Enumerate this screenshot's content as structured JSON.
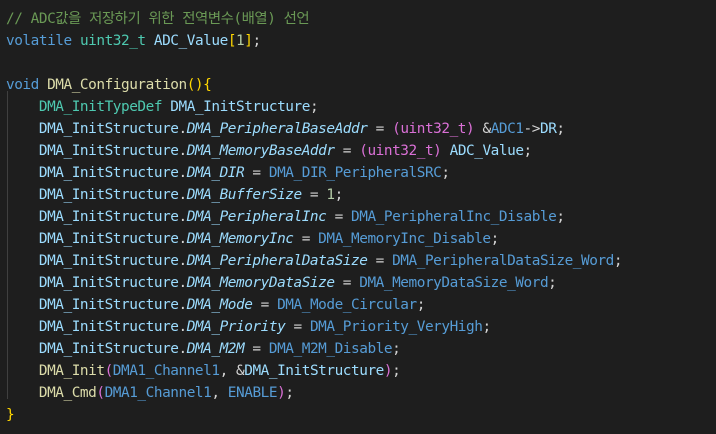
{
  "editor": {
    "lines": [
      [
        [
          "// ADC값을 저장하기 위한 전역변수(배열) 선언",
          "comment"
        ]
      ],
      [
        [
          "volatile",
          "keyword"
        ],
        [
          " ",
          "punct"
        ],
        [
          "uint32_t",
          "type"
        ],
        [
          " ",
          "punct"
        ],
        [
          "ADC_Value",
          "ident"
        ],
        [
          "[",
          "bracket1"
        ],
        [
          "1",
          "number"
        ],
        [
          "]",
          "bracket1"
        ],
        [
          ";",
          "punct"
        ]
      ],
      [],
      [
        [
          "void",
          "keyword"
        ],
        [
          " ",
          "punct"
        ],
        [
          "DMA_Configuration",
          "func"
        ],
        [
          "()",
          "bracket1"
        ],
        [
          "{",
          "bracket1"
        ]
      ],
      [
        [
          "    ",
          "punct"
        ],
        [
          "DMA_InitTypeDef",
          "type"
        ],
        [
          " ",
          "punct"
        ],
        [
          "DMA_InitStructure",
          "ident"
        ],
        [
          ";",
          "punct"
        ]
      ],
      [
        [
          "    ",
          "punct"
        ],
        [
          "DMA_InitStructure",
          "ident"
        ],
        [
          ".",
          "punct"
        ],
        [
          "DMA_PeripheralBaseAddr",
          "ident italic"
        ],
        [
          " = ",
          "punct"
        ],
        [
          "(",
          "bracket2"
        ],
        [
          "uint32_t",
          "bracket2"
        ],
        [
          ")",
          "bracket2"
        ],
        [
          " &",
          "punct"
        ],
        [
          "ADC1",
          "macro"
        ],
        [
          "->",
          "punct"
        ],
        [
          "DR",
          "ident"
        ],
        [
          ";",
          "punct"
        ]
      ],
      [
        [
          "    ",
          "punct"
        ],
        [
          "DMA_InitStructure",
          "ident"
        ],
        [
          ".",
          "punct"
        ],
        [
          "DMA_MemoryBaseAddr",
          "ident italic"
        ],
        [
          " = ",
          "punct"
        ],
        [
          "(",
          "bracket2"
        ],
        [
          "uint32_t",
          "bracket2"
        ],
        [
          ")",
          "bracket2"
        ],
        [
          " ",
          "punct"
        ],
        [
          "ADC_Value",
          "ident"
        ],
        [
          ";",
          "punct"
        ]
      ],
      [
        [
          "    ",
          "punct"
        ],
        [
          "DMA_InitStructure",
          "ident"
        ],
        [
          ".",
          "punct"
        ],
        [
          "DMA_DIR",
          "ident italic"
        ],
        [
          " = ",
          "punct"
        ],
        [
          "DMA_DIR_PeripheralSRC",
          "macro"
        ],
        [
          ";",
          "punct"
        ]
      ],
      [
        [
          "    ",
          "punct"
        ],
        [
          "DMA_InitStructure",
          "ident"
        ],
        [
          ".",
          "punct"
        ],
        [
          "DMA_BufferSize",
          "ident italic"
        ],
        [
          " = ",
          "punct"
        ],
        [
          "1",
          "number"
        ],
        [
          ";",
          "punct"
        ]
      ],
      [
        [
          "    ",
          "punct"
        ],
        [
          "DMA_InitStructure",
          "ident"
        ],
        [
          ".",
          "punct"
        ],
        [
          "DMA_PeripheralInc",
          "ident italic"
        ],
        [
          " = ",
          "punct"
        ],
        [
          "DMA_PeripheralInc_Disable",
          "macro"
        ],
        [
          ";",
          "punct"
        ]
      ],
      [
        [
          "    ",
          "punct"
        ],
        [
          "DMA_InitStructure",
          "ident"
        ],
        [
          ".",
          "punct"
        ],
        [
          "DMA_MemoryInc",
          "ident italic"
        ],
        [
          " = ",
          "punct"
        ],
        [
          "DMA_MemoryInc_Disable",
          "macro"
        ],
        [
          ";",
          "punct"
        ]
      ],
      [
        [
          "    ",
          "punct"
        ],
        [
          "DMA_InitStructure",
          "ident"
        ],
        [
          ".",
          "punct"
        ],
        [
          "DMA_PeripheralDataSize",
          "ident italic"
        ],
        [
          " = ",
          "punct"
        ],
        [
          "DMA_PeripheralDataSize_Word",
          "macro"
        ],
        [
          ";",
          "punct"
        ]
      ],
      [
        [
          "    ",
          "punct"
        ],
        [
          "DMA_InitStructure",
          "ident"
        ],
        [
          ".",
          "punct"
        ],
        [
          "DMA_MemoryDataSize",
          "ident italic"
        ],
        [
          " = ",
          "punct"
        ],
        [
          "DMA_MemoryDataSize_Word",
          "macro"
        ],
        [
          ";",
          "punct"
        ]
      ],
      [
        [
          "    ",
          "punct"
        ],
        [
          "DMA_InitStructure",
          "ident"
        ],
        [
          ".",
          "punct"
        ],
        [
          "DMA_Mode",
          "ident italic"
        ],
        [
          " = ",
          "punct"
        ],
        [
          "DMA_Mode_Circular",
          "macro"
        ],
        [
          ";",
          "punct"
        ]
      ],
      [
        [
          "    ",
          "punct"
        ],
        [
          "DMA_InitStructure",
          "ident"
        ],
        [
          ".",
          "punct"
        ],
        [
          "DMA_Priority",
          "ident italic"
        ],
        [
          " = ",
          "punct"
        ],
        [
          "DMA_Priority_VeryHigh",
          "macro"
        ],
        [
          ";",
          "punct"
        ]
      ],
      [
        [
          "    ",
          "punct"
        ],
        [
          "DMA_InitStructure",
          "ident"
        ],
        [
          ".",
          "punct"
        ],
        [
          "DMA_M2M",
          "ident italic"
        ],
        [
          " = ",
          "punct"
        ],
        [
          "DMA_M2M_Disable",
          "macro"
        ],
        [
          ";",
          "punct"
        ]
      ],
      [
        [
          "    ",
          "punct"
        ],
        [
          "DMA_Init",
          "func"
        ],
        [
          "(",
          "bracket2"
        ],
        [
          "DMA1_Channel1",
          "macro"
        ],
        [
          ", &",
          "punct"
        ],
        [
          "DMA_InitStructure",
          "ident"
        ],
        [
          ")",
          "bracket2"
        ],
        [
          ";",
          "punct"
        ]
      ],
      [
        [
          "    ",
          "punct"
        ],
        [
          "DMA_Cmd",
          "func"
        ],
        [
          "(",
          "bracket2"
        ],
        [
          "DMA1_Channel1",
          "macro"
        ],
        [
          ", ",
          "punct"
        ],
        [
          "ENABLE",
          "macro"
        ],
        [
          ")",
          "bracket2"
        ],
        [
          ";",
          "punct"
        ]
      ],
      [
        [
          "}",
          "bracket1"
        ]
      ]
    ]
  },
  "theme": {
    "background": "#1e1e1e",
    "comment": "#6a9955",
    "keyword": "#569cd6",
    "type": "#4ec9b0",
    "function": "#dcdcaa",
    "identifier": "#9cdcfe",
    "number": "#b5cea8",
    "bracket_gold": "#ffd700",
    "bracket_orchid": "#da70d6"
  }
}
